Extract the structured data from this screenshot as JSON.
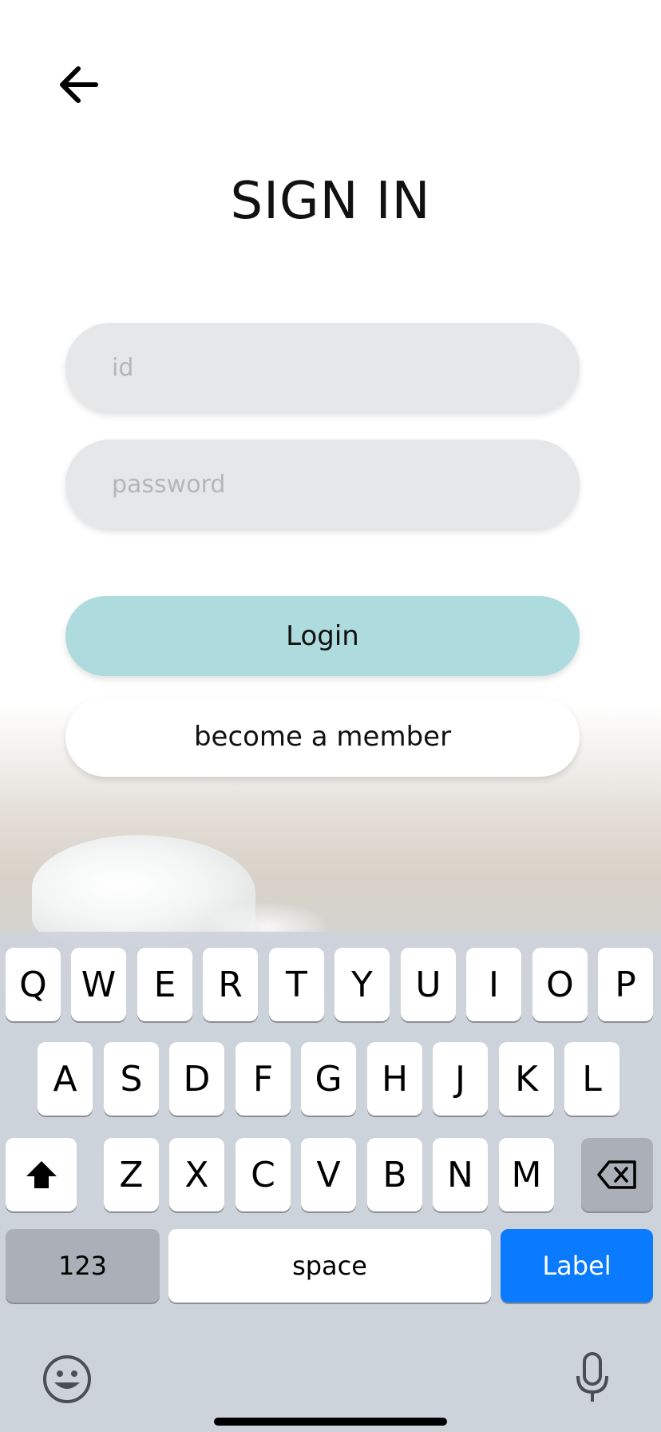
{
  "header": {
    "back_icon": "arrow-left-icon"
  },
  "title": "SIGN IN",
  "form": {
    "id_placeholder": "id",
    "id_value": "",
    "password_placeholder": "password",
    "password_value": "",
    "login_label": "Login",
    "member_label": "become a member"
  },
  "colors": {
    "login_button": "#aedbdd",
    "field_background": "#e6e7e8",
    "keyboard_action": "#0a7aff"
  },
  "keyboard": {
    "row1": [
      "Q",
      "W",
      "E",
      "R",
      "T",
      "Y",
      "U",
      "I",
      "O",
      "P"
    ],
    "row2": [
      "A",
      "S",
      "D",
      "F",
      "G",
      "H",
      "J",
      "K",
      "L"
    ],
    "row3": [
      "Z",
      "X",
      "C",
      "V",
      "B",
      "N",
      "M"
    ],
    "shift_icon": "shift-icon",
    "backspace_icon": "backspace-icon",
    "numbers_label": "123",
    "space_label": "space",
    "action_label": "Label",
    "emoji_icon": "emoji-icon",
    "mic_icon": "microphone-icon"
  }
}
